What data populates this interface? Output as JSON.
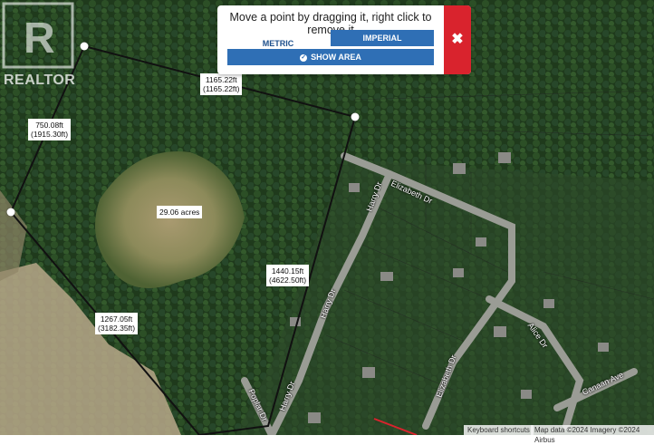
{
  "toolbox": {
    "instruction": "Move a point by dragging it, right click to remove it",
    "metric_label": "METRIC",
    "imperial_label": "IMPERIAL",
    "show_area_label": "SHOW AREA",
    "close_symbol": "✖"
  },
  "measurements": {
    "top_edge_1": "1165.22ft",
    "top_edge_2": "(1165.22ft)",
    "left_edge_1": "750.08ft",
    "left_edge_2": "(1915.30ft)",
    "right_edge_1": "1440.15ft",
    "right_edge_2": "(4622.50ft)",
    "bottom_edge_1": "1267.05ft",
    "bottom_edge_2": "(3182.35ft)",
    "area": "29.06 acres"
  },
  "streets": {
    "elizabeth_dr_1": "Elizabeth Dr",
    "elizabeth_dr_2": "Elizabeth Dr",
    "harry_dr_1": "Harry Dr",
    "harry_dr_2": "Harry Dr",
    "harry_dr_3": "Harry Dr",
    "poplar_dr": "Poplar Dr",
    "alice_dr": "Alice Dr",
    "canaan_ave": "Canaan Ave"
  },
  "watermark": {
    "text": "REALTOR"
  },
  "attribution": {
    "keyboard": "Keyboard shortcuts",
    "map_data": "Map data ©2024 Imagery ©2024 Airbus"
  },
  "colors": {
    "accent_blue": "#2f6fb5",
    "close_red": "#d9232d"
  }
}
